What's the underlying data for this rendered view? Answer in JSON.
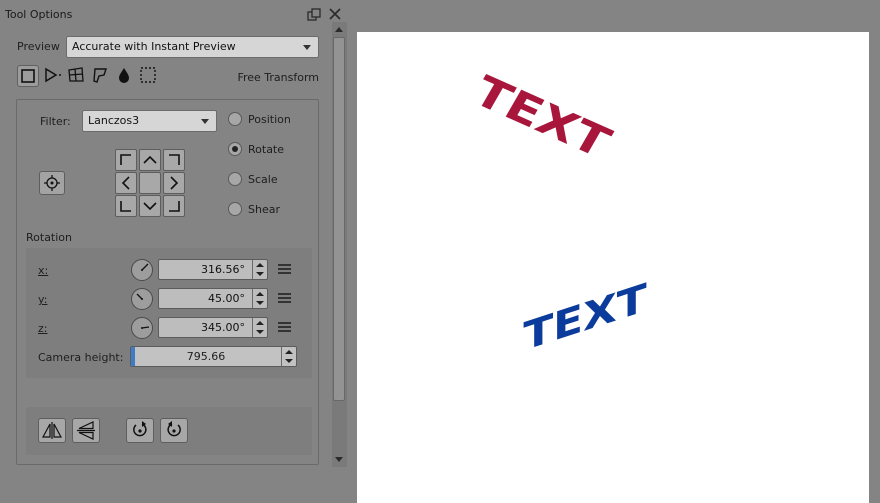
{
  "panel": {
    "title": "Tool Options"
  },
  "preview": {
    "label": "Preview",
    "selected": "Accurate with Instant Preview"
  },
  "modes": {
    "current_label": "Free Transform",
    "items": [
      {
        "icon": "free-transform-icon",
        "active": true
      },
      {
        "icon": "perspective-icon",
        "active": false
      },
      {
        "icon": "warp-icon",
        "active": false
      },
      {
        "icon": "cage-icon",
        "active": false
      },
      {
        "icon": "liquify-icon",
        "active": false
      },
      {
        "icon": "mesh-icon",
        "active": false
      }
    ]
  },
  "filter": {
    "label": "Filter:",
    "selected": "Lanczos3"
  },
  "operations": [
    {
      "label": "Position",
      "checked": false
    },
    {
      "label": "Rotate",
      "checked": true
    },
    {
      "label": "Scale",
      "checked": false
    },
    {
      "label": "Shear",
      "checked": false
    }
  ],
  "rotation": {
    "section_label": "Rotation",
    "x": {
      "label": "x:",
      "value": "316.56°"
    },
    "y": {
      "label": "y:",
      "value": "45.00°"
    },
    "z": {
      "label": "z:",
      "value": "345.00°"
    },
    "camera": {
      "label": "Camera height:",
      "value": "795.66"
    }
  },
  "canvas": {
    "text_red": "TEXT",
    "text_blue": "TEXT",
    "colors": {
      "red": "#a8163b",
      "blue": "#0b3c9c",
      "background": "#ffffff"
    }
  }
}
